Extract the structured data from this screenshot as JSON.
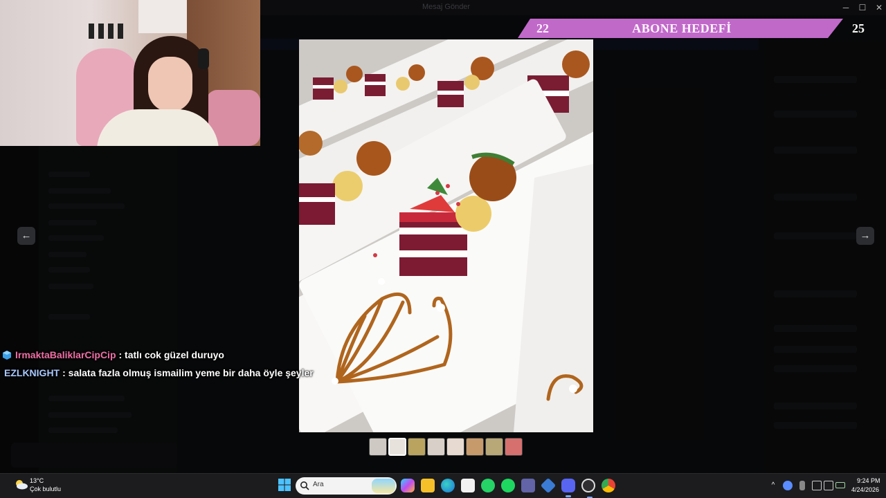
{
  "window": {
    "title": "Mesaj Gönder",
    "controls": {
      "minimize": "─",
      "maximize": "☐",
      "close": "✕"
    }
  },
  "subscriber_goal": {
    "current": "22",
    "label": "ABONE HEDEFİ",
    "target": "25",
    "color": "#c069c9"
  },
  "viewer": {
    "prev_icon": "arrow-left-icon",
    "next_icon": "arrow-right-icon",
    "prev_glyph": "←",
    "next_glyph": "→",
    "thumbnails": [
      {
        "id": "t1",
        "color": "#cfc9c4"
      },
      {
        "id": "t2",
        "color": "#e8e2dd",
        "active": true
      },
      {
        "id": "t3",
        "color": "#b9a35f"
      },
      {
        "id": "t4",
        "color": "#d8d0c8"
      },
      {
        "id": "t5",
        "color": "#e7dbd1"
      },
      {
        "id": "t6",
        "color": "#c79a6b"
      },
      {
        "id": "t7",
        "color": "#b8a878"
      },
      {
        "id": "t8",
        "color": "#d6706f"
      }
    ]
  },
  "chat": {
    "messages": [
      {
        "user": "IrmaktaBaliklarCipCip",
        "text": ": tatlı cok güzel duruyo",
        "user_color": "#f06fa6",
        "badge": true
      },
      {
        "user": "EZLKNIGHT",
        "text": ": salata fazla olmuş ismailim yeme bir daha öyle şeyler",
        "user_color": "#a9c8ff",
        "badge": false
      }
    ]
  },
  "taskbar": {
    "weather": {
      "temp": "13°C",
      "desc": "Çok bulutlu"
    },
    "search": {
      "placeholder": "Ara"
    },
    "apps": [
      "copilot-icon",
      "file-explorer-icon",
      "edge-icon",
      "store-icon",
      "whatsapp-icon",
      "spotify-icon",
      "teams-icon",
      "app-icon",
      "discord-icon",
      "obs-icon",
      "chrome-icon"
    ],
    "tray": {
      "overflow": "^",
      "time": "9:24 PM",
      "date": "4/24/2026"
    }
  }
}
